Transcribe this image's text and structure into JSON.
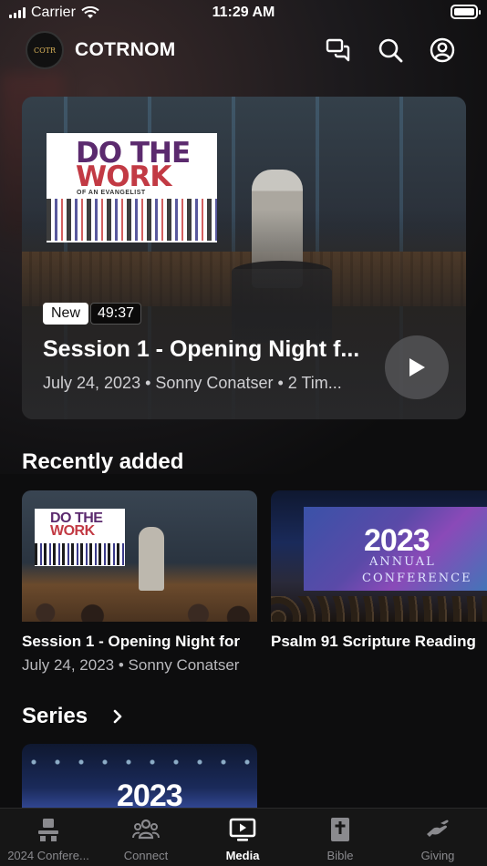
{
  "status_bar": {
    "carrier": "Carrier",
    "time": "11:29 AM"
  },
  "header": {
    "logo_text": "COTR",
    "app_name": "COTRNOM"
  },
  "hero": {
    "badge_new": "New",
    "duration": "49:37",
    "poster_line1": "DO THE",
    "poster_line2": "WORK",
    "poster_sub": "OF AN EVANGELIST",
    "title": "Session 1 - Opening Night f...",
    "meta": "July 24, 2023 • Sonny Conatser • 2 Tim..."
  },
  "recently_added": {
    "title": "Recently added",
    "items": [
      {
        "title": "Session 1 - Opening Night for",
        "meta": "July 24, 2023 • Sonny Conatser",
        "poster_line1": "DO THE",
        "poster_line2": "WORK"
      },
      {
        "title": "Psalm 91 Scripture Reading",
        "meta": "",
        "year": "2023",
        "subtitle_1": "ANNUAL",
        "subtitle_2": "CONFERENCE"
      }
    ]
  },
  "series": {
    "title": "Series",
    "first_year": "2023"
  },
  "tabs": [
    {
      "label": "2024 Confere...",
      "icon": "conference-icon",
      "active": false
    },
    {
      "label": "Connect",
      "icon": "people-icon",
      "active": false
    },
    {
      "label": "Media",
      "icon": "tv-play-icon",
      "active": true
    },
    {
      "label": "Bible",
      "icon": "bible-icon",
      "active": false
    },
    {
      "label": "Giving",
      "icon": "giving-hand-icon",
      "active": false
    }
  ]
}
